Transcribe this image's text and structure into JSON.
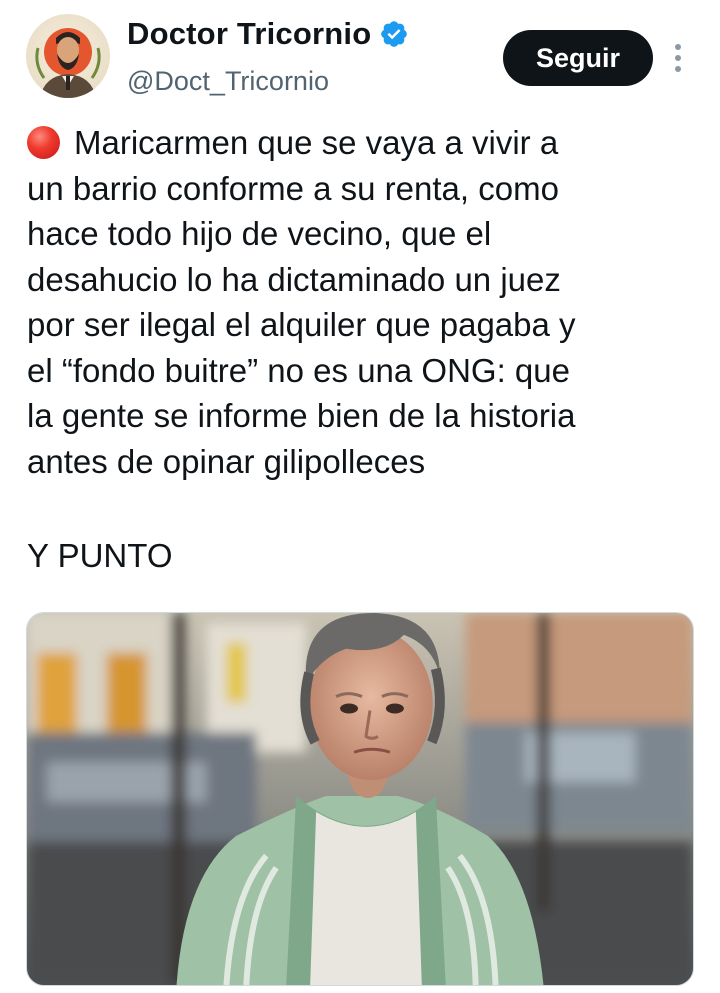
{
  "author": {
    "display_name": "Doctor Tricornio",
    "handle": "@Doct_Tricornio",
    "verified": true,
    "avatar_icon": "bearded-man-portrait-avatar"
  },
  "actions": {
    "follow_label": "Seguir",
    "more_icon": "vertical-ellipsis-icon"
  },
  "tweet": {
    "leading_icon": "red-circle-emoji",
    "text": "Maricarmen que se vaya a vivir a\nun barrio conforme a su renta, como\nhace todo hijo de vecino, que el\ndesahucio lo ha dictaminado un juez\npor ser ilegal el alquiler que pagaba y\nel “fondo buitre” no es una ONG: que\nla gente se informe bien de la historia\nantes de opinar gilipolleces",
    "closing": "Y PUNTO"
  },
  "media": {
    "type": "photo",
    "subject": "elderly-woman-street-photo"
  },
  "colors": {
    "text": "#0f1419",
    "secondary_text": "#536471",
    "follow_button_bg": "#0f1419",
    "verified_blue": "#1d9bf0",
    "red_dot": "#e0252b"
  }
}
